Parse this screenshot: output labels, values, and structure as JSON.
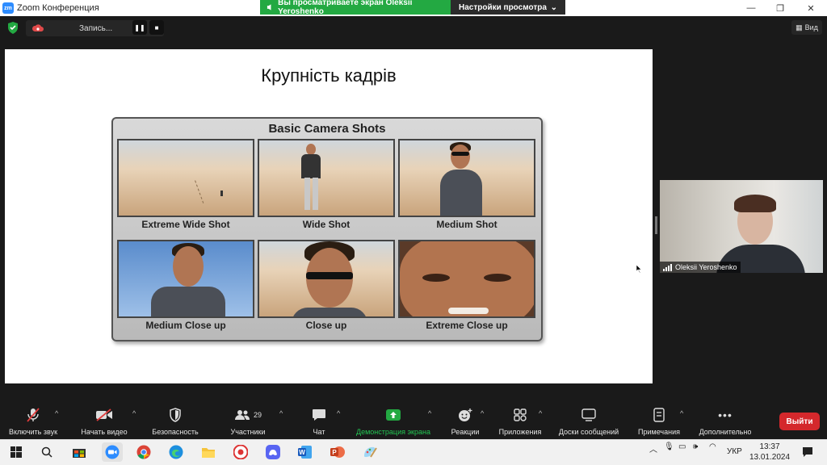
{
  "window": {
    "app_icon": "zm",
    "title": "Zoom Конференция"
  },
  "share_banner": {
    "status": "Вы просматриваете экран Oleksii Yeroshenko",
    "options_label": "Настройки просмотра"
  },
  "recording": {
    "status": "Запись...",
    "pause_icon": "pause-icon",
    "stop_icon": "stop-icon"
  },
  "view_button": {
    "label": "Вид"
  },
  "slide": {
    "title": "Крупність кадрів",
    "poster_title": "Basic Camera Shots",
    "shots": [
      {
        "caption": "Extreme Wide Shot"
      },
      {
        "caption": "Wide Shot"
      },
      {
        "caption": "Medium Shot"
      },
      {
        "caption": "Medium Close up"
      },
      {
        "caption": "Close up"
      },
      {
        "caption": "Extreme Close up"
      }
    ]
  },
  "participant": {
    "name": "Oleksii Yeroshenko"
  },
  "toolbar": {
    "unmute": "Включить звук",
    "start_video": "Начать видео",
    "security": "Безопасность",
    "participants": "Участники",
    "participants_count": "29",
    "chat": "Чат",
    "share_screen": "Демонстрация экрана",
    "reactions": "Реакции",
    "apps": "Приложения",
    "whiteboards": "Доски сообщений",
    "notes": "Примечания",
    "more": "Дополнительно",
    "leave": "Выйти"
  },
  "taskbar": {
    "language": "УКР",
    "time": "13:37",
    "date": "13.01.2024"
  },
  "colors": {
    "share_green": "#23a942",
    "leave_red": "#d4282c",
    "zoom_blue": "#2d8cff",
    "toolbar_bg": "#1a1a1a"
  }
}
